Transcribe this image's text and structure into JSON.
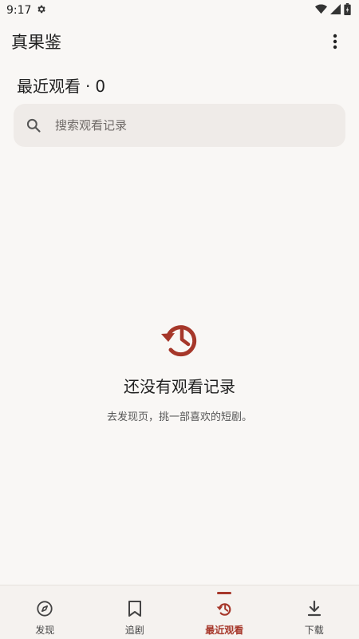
{
  "status_bar": {
    "time": "9:17"
  },
  "app": {
    "title": "真果鉴"
  },
  "section": {
    "title": "最近观看",
    "separator": "·",
    "count": "0"
  },
  "search": {
    "placeholder": "搜索观看记录",
    "value": ""
  },
  "empty_state": {
    "title": "还没有观看记录",
    "subtitle": "去发现页，挑一部喜欢的短剧。"
  },
  "nav": {
    "items": [
      {
        "label": "发现",
        "icon": "compass-icon",
        "active": false
      },
      {
        "label": "追剧",
        "icon": "bookmark-icon",
        "active": false
      },
      {
        "label": "最近观看",
        "icon": "history-icon",
        "active": true
      },
      {
        "label": "下载",
        "icon": "download-icon",
        "active": false
      }
    ]
  },
  "colors": {
    "accent": "#a6372a",
    "background": "#f9f7f5",
    "search_bg": "#efebe8"
  }
}
